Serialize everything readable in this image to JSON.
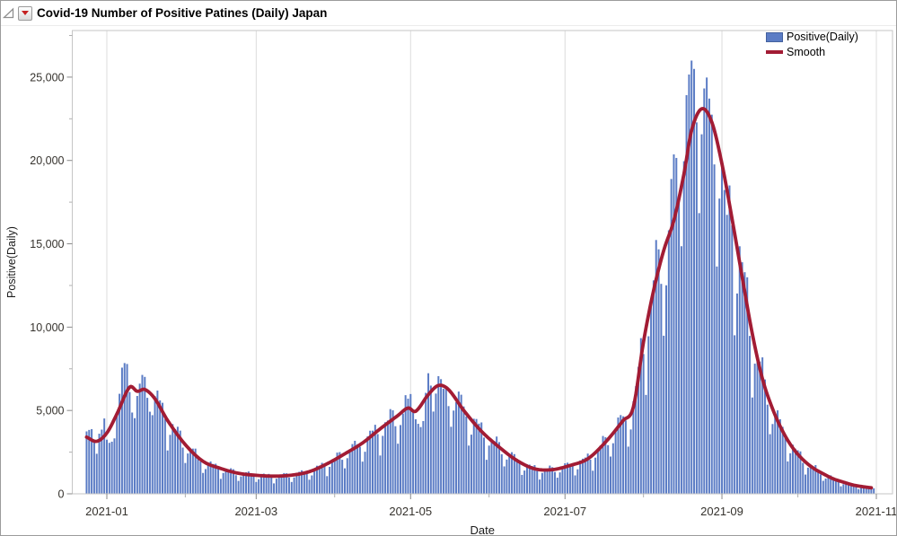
{
  "window": {
    "title": "Covid-19 Number of Positive Patines (Daily) Japan",
    "icons": {
      "disclosure": "open-disclosure-triangle-icon",
      "menu": "red-dropdown-menu-icon"
    }
  },
  "chart_data": {
    "type": "bar",
    "overlay_type": "line",
    "title": "Covid-19 Number of Positive Patines (Daily) Japan",
    "xlabel": "Date",
    "ylabel": "Positive(Daily)",
    "grid": "vertical-only",
    "x_axis": {
      "major_ticks": [
        {
          "date": "2021-01-01",
          "label": "2021-01"
        },
        {
          "date": "2021-03-01",
          "label": "2021-03"
        },
        {
          "date": "2021-05-01",
          "label": "2021-05"
        },
        {
          "date": "2021-07-01",
          "label": "2021-07"
        },
        {
          "date": "2021-09-01",
          "label": "2021-09"
        },
        {
          "date": "2021-11-01",
          "label": "2021-11"
        }
      ],
      "minor_tick_dates": [
        "2021-02-01",
        "2021-04-01",
        "2021-06-01",
        "2021-08-01",
        "2021-10-01"
      ]
    },
    "y_axis": {
      "major_ticks": [
        {
          "value": 0,
          "label": "0"
        },
        {
          "value": 5000,
          "label": "5,000"
        },
        {
          "value": 10000,
          "label": "10,000"
        },
        {
          "value": 15000,
          "label": "15,000"
        },
        {
          "value": 20000,
          "label": "20,000"
        },
        {
          "value": 25000,
          "label": "25,000"
        }
      ],
      "minor_tick_values": [
        2500,
        7500,
        12500,
        17500,
        22500,
        27500
      ],
      "range": [
        0,
        27800
      ]
    },
    "bars": {
      "name": "Positive(Daily)",
      "start_date": "2020-12-24",
      "end_date": "2021-10-31",
      "weekday_factors": [
        0.93,
        0.62,
        0.84,
        1.02,
        1.09,
        1.13,
        1.1
      ],
      "daily_overrides": {
        "2020-12-24": 3744,
        "2020-12-25": 3832,
        "2020-12-26": 3881,
        "2020-12-27": 3128,
        "2020-12-28": 2403,
        "2020-12-29": 3606,
        "2020-12-30": 3852,
        "2020-12-31": 4520,
        "2021-01-01": 3246,
        "2021-01-02": 3059,
        "2021-01-03": 3127,
        "2021-01-04": 3325,
        "2021-01-05": 4915,
        "2021-01-06": 6001,
        "2021-01-07": 7570,
        "2021-01-08": 7844,
        "2021-01-09": 7790,
        "2021-01-10": 6106,
        "2021-01-11": 4876,
        "2021-01-12": 4538,
        "2021-01-13": 5870,
        "2021-01-14": 6609,
        "2021-01-15": 7133,
        "2021-01-16": 7014,
        "2021-01-17": 5759,
        "2021-01-18": 4925,
        "2021-04-29": 5918,
        "2021-04-30": 5708,
        "2021-05-01": 5986,
        "2021-05-02": 5040,
        "2021-05-03": 4471,
        "2021-05-04": 4199,
        "2021-05-05": 4004,
        "2021-05-06": 4365,
        "2021-05-07": 6058,
        "2021-05-08": 7234,
        "2021-05-09": 6493,
        "2021-05-10": 4935,
        "2021-05-11": 6013,
        "2021-05-12": 7057,
        "2021-05-13": 6879,
        "2021-05-14": 6300,
        "2021-05-15": 6421,
        "2021-05-16": 5261,
        "2021-05-17": 4023,
        "2021-08-11": 15812,
        "2021-08-12": 18889,
        "2021-08-13": 20365,
        "2021-08-14": 20151,
        "2021-08-15": 17832,
        "2021-08-16": 14854,
        "2021-08-17": 19955,
        "2021-08-18": 23917,
        "2021-08-19": 25156,
        "2021-08-20": 25992,
        "2021-08-21": 25492,
        "2021-08-22": 22284,
        "2021-08-23": 16842,
        "2021-08-24": 21569,
        "2021-08-25": 24321,
        "2021-08-26": 24976,
        "2021-08-27": 23713,
        "2021-08-28": 22750,
        "2021-08-29": 19762,
        "2021-08-30": 13638,
        "2021-08-31": 17713,
        "2021-09-01": 20031,
        "2021-09-02": 18228,
        "2021-09-03": 16738
      }
    },
    "smooth": {
      "name": "Smooth",
      "anchors": [
        [
          "2020-12-24",
          3400
        ],
        [
          "2020-12-28",
          3150
        ],
        [
          "2021-01-01",
          3650
        ],
        [
          "2021-01-05",
          4800
        ],
        [
          "2021-01-10",
          6400
        ],
        [
          "2021-01-13",
          6150
        ],
        [
          "2021-01-16",
          6260
        ],
        [
          "2021-01-20",
          5700
        ],
        [
          "2021-01-25",
          4400
        ],
        [
          "2021-02-01",
          2950
        ],
        [
          "2021-02-08",
          1950
        ],
        [
          "2021-02-15",
          1520
        ],
        [
          "2021-02-22",
          1230
        ],
        [
          "2021-03-01",
          1110
        ],
        [
          "2021-03-08",
          1060
        ],
        [
          "2021-03-15",
          1120
        ],
        [
          "2021-03-22",
          1330
        ],
        [
          "2021-03-29",
          1800
        ],
        [
          "2021-04-05",
          2400
        ],
        [
          "2021-04-12",
          3050
        ],
        [
          "2021-04-19",
          3900
        ],
        [
          "2021-04-26",
          4700
        ],
        [
          "2021-04-30",
          5150
        ],
        [
          "2021-05-03",
          4950
        ],
        [
          "2021-05-08",
          5950
        ],
        [
          "2021-05-12",
          6500
        ],
        [
          "2021-05-16",
          6250
        ],
        [
          "2021-05-22",
          5000
        ],
        [
          "2021-05-29",
          3750
        ],
        [
          "2021-06-05",
          2800
        ],
        [
          "2021-06-12",
          2000
        ],
        [
          "2021-06-19",
          1500
        ],
        [
          "2021-06-26",
          1450
        ],
        [
          "2021-07-03",
          1700
        ],
        [
          "2021-07-10",
          2100
        ],
        [
          "2021-07-17",
          3100
        ],
        [
          "2021-07-24",
          4400
        ],
        [
          "2021-07-28",
          5200
        ],
        [
          "2021-08-01",
          9100
        ],
        [
          "2021-08-05",
          12200
        ],
        [
          "2021-08-09",
          14600
        ],
        [
          "2021-08-13",
          16400
        ],
        [
          "2021-08-17",
          19200
        ],
        [
          "2021-08-20",
          21800
        ],
        [
          "2021-08-24",
          23100
        ],
        [
          "2021-08-28",
          22300
        ],
        [
          "2021-09-01",
          19800
        ],
        [
          "2021-09-05",
          16500
        ],
        [
          "2021-09-09",
          13000
        ],
        [
          "2021-09-13",
          9600
        ],
        [
          "2021-09-17",
          6900
        ],
        [
          "2021-09-21",
          5100
        ],
        [
          "2021-09-25",
          3750
        ],
        [
          "2021-09-29",
          2750
        ],
        [
          "2021-10-03",
          2050
        ],
        [
          "2021-10-07",
          1550
        ],
        [
          "2021-10-11",
          1200
        ],
        [
          "2021-10-15",
          900
        ],
        [
          "2021-10-19",
          700
        ],
        [
          "2021-10-23",
          520
        ],
        [
          "2021-10-27",
          420
        ],
        [
          "2021-10-30",
          360
        ]
      ]
    },
    "legend": {
      "position": "top-right",
      "items": [
        {
          "label": "Positive(Daily)",
          "swatch": "bar",
          "color": "#5b7cc5"
        },
        {
          "label": "Smooth",
          "swatch": "line",
          "color": "#a21c34"
        }
      ]
    },
    "colors": {
      "bar": "#5b7cc5",
      "smooth": "#a21c34",
      "grid": "#dcdcdc",
      "plot_border": "#c6c6c6",
      "major_tick": "#8a8a8a",
      "minor_tick": "#b0b0b0",
      "tick_text": "#35322d",
      "axis_title_text": "#1a1a1a"
    }
  }
}
